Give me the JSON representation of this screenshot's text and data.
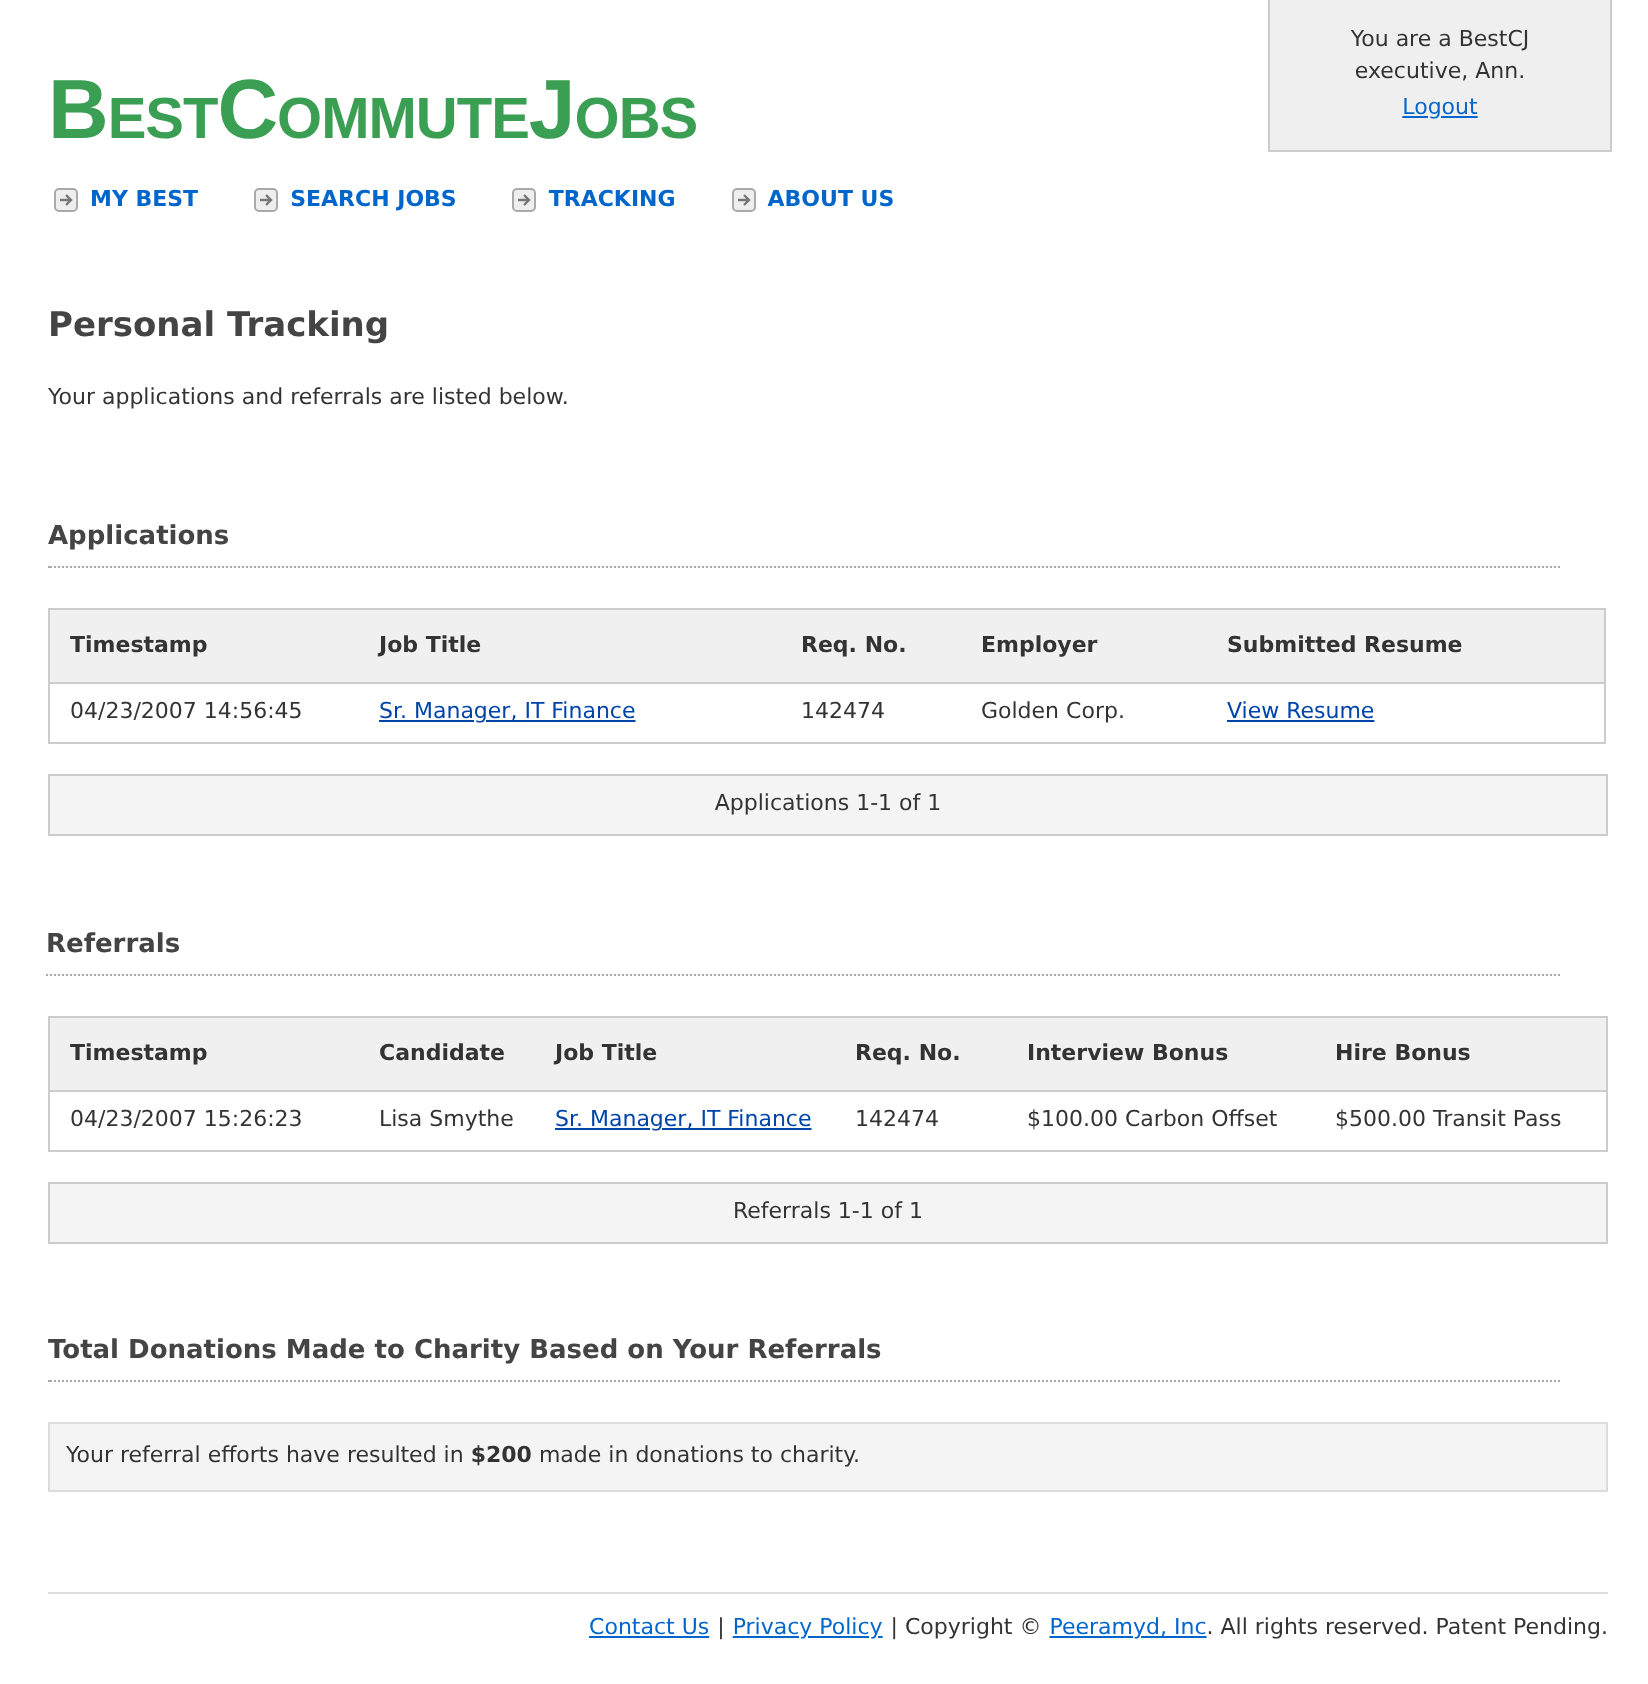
{
  "logo": "BestCommuteJobs",
  "account": {
    "greeting": "You are a BestCJ executive, Ann.",
    "logout": "Logout"
  },
  "nav": [
    {
      "label": "MY BEST"
    },
    {
      "label": "SEARCH JOBS"
    },
    {
      "label": "TRACKING"
    },
    {
      "label": "ABOUT US"
    }
  ],
  "page_title": "Personal Tracking",
  "intro": "Your applications and referrals are listed below.",
  "sections": [
    {
      "heading": "Applications",
      "columns": [
        "Timestamp",
        "Job Title",
        "Req. No.",
        "Employer",
        "Submitted Resume"
      ],
      "rows": [
        [
          {
            "text": "04/23/2007 14:56:45",
            "kind": "text"
          },
          {
            "text": "Sr. Manager, IT Finance",
            "kind": "link"
          },
          {
            "text": "142474",
            "kind": "text"
          },
          {
            "text": "Golden Corp.",
            "kind": "text"
          },
          {
            "text": "View Resume",
            "kind": "link"
          }
        ]
      ],
      "pager": "Applications 1-1 of 1"
    },
    {
      "heading": "Referrals",
      "columns": [
        "Timestamp",
        "Candidate",
        "Job Title",
        "Req. No.",
        "Interview Bonus",
        "Hire Bonus"
      ],
      "rows": [
        [
          {
            "text": "04/23/2007 15:26:23",
            "kind": "text"
          },
          {
            "text": "Lisa Smythe",
            "kind": "text"
          },
          {
            "text": "Sr. Manager, IT Finance",
            "kind": "link"
          },
          {
            "text": "142474",
            "kind": "text"
          },
          {
            "text": "$100.00 Carbon Offset",
            "kind": "text"
          },
          {
            "text": "$500.00 Transit Pass",
            "kind": "text"
          }
        ]
      ],
      "pager": "Referrals 1-1 of 1"
    }
  ],
  "donations": {
    "heading": "Total Donations Made to Charity Based on Your Referrals",
    "message": "Your referral efforts have resulted in **$200** made in donations to charity."
  },
  "footer": [
    {
      "text": "Contact Us",
      "kind": "link"
    },
    {
      "text": "|",
      "kind": "text"
    },
    {
      "text": "Privacy Policy",
      "kind": "link"
    },
    {
      "text": "| Copyright ©",
      "kind": "text"
    },
    {
      "text": "Peeramyd, Inc",
      "kind": "link"
    },
    {
      "text": ". All rights reserved. Patent Pending.",
      "kind": "text"
    }
  ]
}
